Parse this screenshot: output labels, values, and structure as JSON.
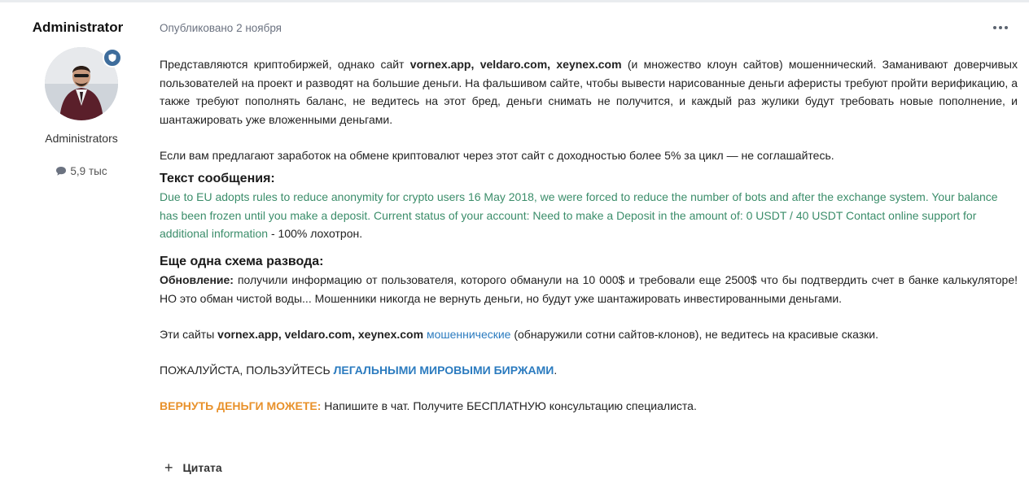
{
  "author": {
    "name": "Administrator",
    "group": "Administrators",
    "posts": "5,9 тыс",
    "badge_color": "#3e6d9c"
  },
  "post": {
    "date": "Опубликовано 2 ноября",
    "intro": {
      "t1": "Представляются криптобиржей, однако сайт ",
      "sites": "vornex.app, veldaro.com, xeynex.com",
      "t2": " (и множество клоун сайтов) мошеннический. Заманивают доверчивых пользователей на проект и разводят на большие деньги. На фальшивом сайте, чтобы вывести нарисованные деньги аферисты требуют пройти верификацию, а также требуют пополнять баланс, не ведитесь на этот бред, деньги снимать не получится, и каждый раз жулики будут требовать новые пополнение, и шантажировать уже вложенными деньгами."
    },
    "warning": "Если вам предлагают заработок на обмене криптовалют через этот сайт с доходностью более 5% за цикл — не соглашайтесь.",
    "message_heading": "Текст сообщения:",
    "message_text": "Due to EU adopts rules to reduce anonymity for crypto users 16 May 2018, we were forced to reduce the number of bots and after the exchange system. Your balance has been frozen until you make a deposit. Current status of your account: Need to make a Deposit in the amount of: 0 USDT / 40 USDT Contact online support for additional information",
    "message_suffix": " - 100% лохотрон.",
    "scheme_heading": "Еще одна схема развода:",
    "update_label": "Обновление:",
    "update_text": " получили информацию от пользователя, которого обманули на 10 000$ и требовали еще 2500$ что бы подтвердить счет в банке калькуляторе! НО это обман чистой воды... Мошенники никогда не вернуть деньги, но будут уже шантажировать инвестированными деньгами.",
    "sites_line": {
      "prefix": "Эти сайты ",
      "sites": "vornex.app, veldaro.com, xeynex.com",
      "link": "мошеннические",
      "suffix": " (обнаружили сотни сайтов-клонов), не ведитесь на красивые сказки."
    },
    "please_line": {
      "prefix": "ПОЖАЛУЙСТА, ПОЛЬЗУЙТЕСЬ ",
      "link": "ЛЕГАЛЬНЫМИ МИРОВЫМИ БИРЖАМИ",
      "suffix": "."
    },
    "refund_line": {
      "label": "ВЕРНУТЬ ДЕНЬГИ МОЖЕТЕ:",
      "text": " Напишите в чат. Получите БЕСПЛАТНУЮ консультацию специалиста."
    },
    "quote_label": "Цитата"
  },
  "colors": {
    "message_green": "#3b8d6a",
    "link_blue": "#2b7bbf",
    "refund_orange": "#e8912b"
  }
}
